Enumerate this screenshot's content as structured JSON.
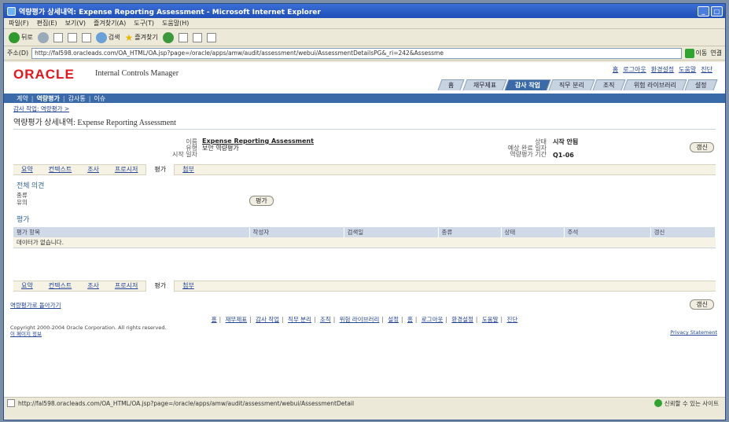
{
  "window": {
    "title": "역량평가 상세내역: Expense Reporting Assessment - Microsoft Internet Explorer",
    "buttons": [
      "_",
      "□"
    ]
  },
  "menu": [
    "파일(F)",
    "편집(E)",
    "보기(V)",
    "즐겨찾기(A)",
    "도구(T)",
    "도움말(H)"
  ],
  "toolbar": {
    "back": "뒤로",
    "search": "검색",
    "favorites": "즐겨찾기"
  },
  "address": {
    "label": "주소(D)",
    "url": "http://fal598.oracleads.com/OA_HTML/OA.jsp?page=/oracle/apps/amw/audit/assessment/webui/AssessmentDetailsPG&_ri=242&Assessme",
    "go": "이동",
    "links": "연결"
  },
  "app": {
    "logo": "ORACLE",
    "product": "Internal Controls Manager",
    "global_links": [
      "홈",
      "로그아웃",
      "환경설정",
      "도움말",
      "진단"
    ],
    "tabs": [
      "홈",
      "재무제표",
      "감사 작업",
      "직무 분리",
      "조직",
      "위험 라이브러리",
      "설정"
    ],
    "active_tab": "감사 작업",
    "nav": [
      "계약",
      "역량평가",
      "감사통",
      "이슈"
    ],
    "breadcrumb": "감사 작업: 역량평가 >",
    "page_title": "역량평가 상세내역: Expense Reporting Assessment",
    "update_button": "갱신"
  },
  "info": {
    "name_label": "이름",
    "name_value": "Expense Reporting Assessment",
    "type_label": "유형",
    "type_value": "보안 역량평가",
    "start_label": "시작 일자",
    "status_label": "상태",
    "status_value": "시작 안됨",
    "due_label": "예상 완료 일자",
    "period_label": "역량평가 기간",
    "period_value": "Q1-06"
  },
  "subtabs": [
    "요약",
    "컨텍스트",
    "조사",
    "프로시저",
    "평가",
    "첨부"
  ],
  "active_subtab": "평가",
  "overall": {
    "heading": "전체 의견",
    "lines": [
      "종류",
      "유의"
    ],
    "eval_button": "평가"
  },
  "evaluation": {
    "heading": "평가",
    "columns": [
      "평가 항목",
      "작성자",
      "검색일",
      "종류",
      "상태",
      "주석",
      "갱신"
    ],
    "empty_text": "데이터가 없습니다."
  },
  "bottom": {
    "return_link": "역량평가로 돌아가기",
    "update_button": "갱신"
  },
  "footer": {
    "links": [
      "홈",
      "재무제표",
      "감사 작업",
      "직무 분리",
      "조직",
      "위험 라이브러리",
      "설정",
      "홈",
      "로그아웃",
      "환경설정",
      "도움말",
      "진단"
    ],
    "copyright": "Copyright 2000-2004 Oracle Corporation. All rights reserved.",
    "about": "이 페이지 정보",
    "privacy": "Privacy Statement"
  },
  "status": {
    "url": "http://fal598.oracleads.com/OA_HTML/OA.jsp?page=/oracle/apps/amw/audit/assessment/webui/AssessmentDetail",
    "zone": "신뢰할 수 있는 사이트"
  }
}
